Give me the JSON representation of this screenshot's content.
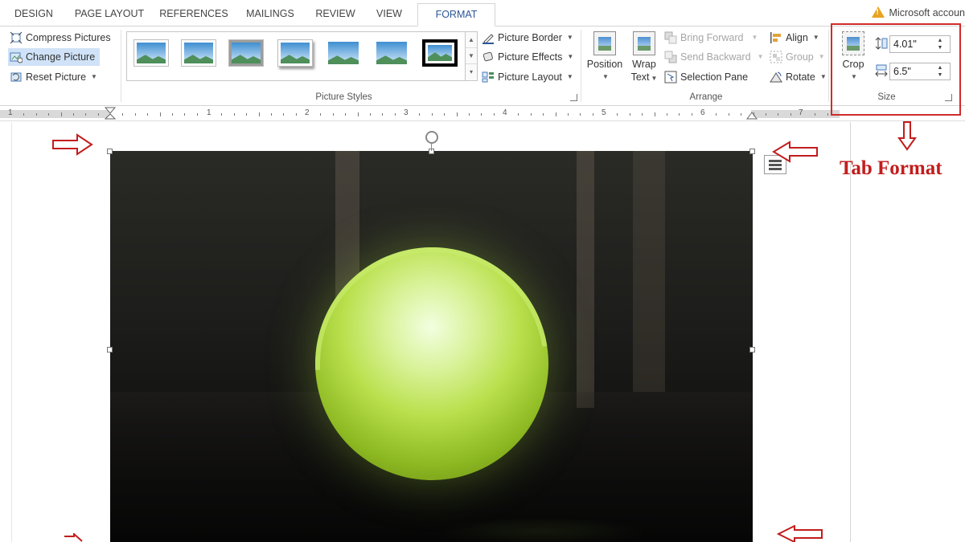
{
  "tabs": [
    {
      "label": "DESIGN",
      "active": false
    },
    {
      "label": "PAGE LAYOUT",
      "active": false
    },
    {
      "label": "REFERENCES",
      "active": false
    },
    {
      "label": "MAILINGS",
      "active": false
    },
    {
      "label": "REVIEW",
      "active": false
    },
    {
      "label": "VIEW",
      "active": false
    },
    {
      "label": "FORMAT",
      "active": true
    }
  ],
  "account": {
    "label": "Microsoft accoun"
  },
  "adjust": {
    "compress": "Compress Pictures",
    "change": "Change Picture",
    "reset": "Reset Picture"
  },
  "picture_styles": {
    "label": "Picture Styles",
    "border": "Picture Border",
    "effects": "Picture Effects",
    "layout": "Picture Layout"
  },
  "arrange": {
    "label": "Arrange",
    "position": "Position",
    "wrap_line1": "Wrap",
    "wrap_line2": "Text",
    "bring_forward": "Bring Forward",
    "send_backward": "Send Backward",
    "selection_pane": "Selection Pane",
    "align": "Align",
    "group": "Group",
    "rotate": "Rotate"
  },
  "size": {
    "label": "Size",
    "crop": "Crop",
    "height": "4.01\"",
    "width": "6.5\""
  },
  "ruler": {
    "numbers": [
      "1",
      "1",
      "2",
      "3",
      "4",
      "5",
      "6",
      "7"
    ]
  },
  "annotation": {
    "text": "Tab Format"
  },
  "colors": {
    "accent": "#2b5797",
    "annotation": "#c21d1d",
    "selection": "#cfe2f7"
  }
}
